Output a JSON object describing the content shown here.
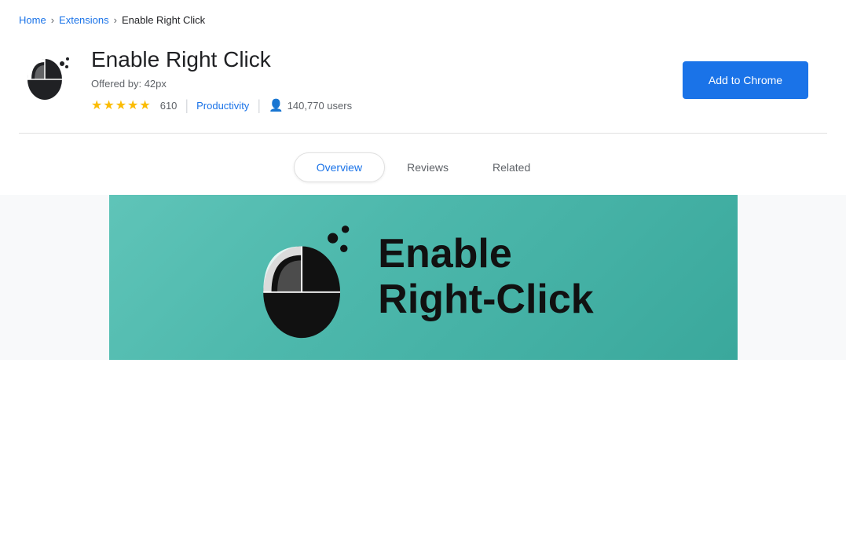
{
  "breadcrumb": {
    "home": "Home",
    "extensions": "Extensions",
    "current": "Enable Right Click"
  },
  "extension": {
    "title": "Enable Right Click",
    "offered_by_label": "Offered by:",
    "offered_by": "42px",
    "rating": "4.5",
    "rating_count": "610",
    "category": "Productivity",
    "users": "140,770 users",
    "add_button_label": "Add to Chrome"
  },
  "tabs": [
    {
      "id": "overview",
      "label": "Overview",
      "active": true
    },
    {
      "id": "reviews",
      "label": "Reviews",
      "active": false
    },
    {
      "id": "related",
      "label": "Related",
      "active": false
    }
  ],
  "banner": {
    "text_line1": "Enable",
    "text_line2": "Right-Click"
  }
}
